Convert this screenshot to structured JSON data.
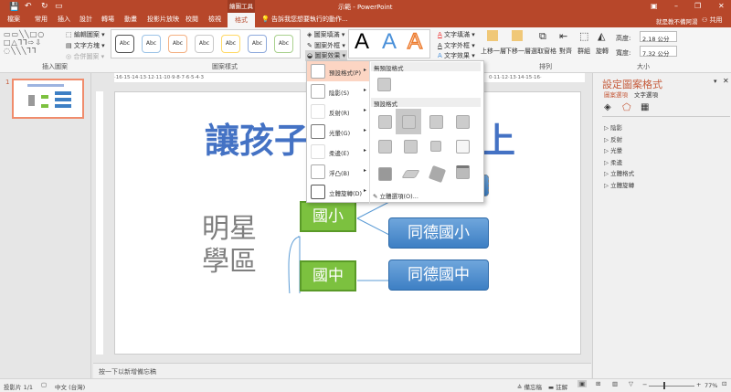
{
  "titlebar": {
    "drawing_tools": "繪圖工具",
    "title": "示範 - PowerPoint",
    "user": "就是教不備阿湯",
    "share": "共用"
  },
  "tabs": [
    "檔案",
    "常用",
    "插入",
    "設計",
    "轉場",
    "動畫",
    "投影片放映",
    "校閱",
    "檢視",
    "格式"
  ],
  "active_tab": "格式",
  "tell_me": "告訴我您想要執行的動作...",
  "ribbon": {
    "insert_shapes": {
      "edit_shape": "編輯圖案",
      "text_box": "文字方塊",
      "merge_shapes": "合併圖案",
      "label": "插入圖案"
    },
    "shape_styles": {
      "sample": "Abc",
      "fill": "圖案填滿",
      "outline": "圖案外框",
      "effects": "圖案效果",
      "label": "圖案樣式"
    },
    "wordart": {
      "sample": "A",
      "text_fill": "文字填滿",
      "text_outline": "文字外框",
      "text_effects": "文字效果"
    },
    "arrange": {
      "bring_forward": "上移一層",
      "send_backward": "下移一層",
      "selection_pane": "選取窗格",
      "align": "對齊",
      "group": "群組",
      "rotate": "旋轉",
      "label": "排列"
    },
    "size": {
      "height_label": "高度:",
      "height": "2.18 公分",
      "width_label": "寬度:",
      "width": "7.32 公分",
      "label": "大小"
    }
  },
  "ruler": {
    "left": "·16·15·14·13·12·11·10·9·8·7·6·5·4·3",
    "right": "0·11·12·13·14·15·16·"
  },
  "slide_number": "1",
  "slide": {
    "title_visible": "讓孩子贏",
    "title_tail": "上",
    "side_label_1": "明星",
    "side_label_2": "學區",
    "green": [
      "國小",
      "國中"
    ],
    "blue": [
      "同德國小",
      "同德國中"
    ]
  },
  "effects_menu": {
    "items": [
      {
        "label": "預設格式(P)"
      },
      {
        "label": "陰影(S)"
      },
      {
        "label": "反射(R)"
      },
      {
        "label": "光暈(G)"
      },
      {
        "label": "柔邊(E)"
      },
      {
        "label": "浮凸(B)"
      },
      {
        "label": "立體旋轉(D)"
      }
    ],
    "no_preset": "無預設格式",
    "presets": "預設格式",
    "options_3d": "立體選項(O)..."
  },
  "pane": {
    "title": "設定圖案格式",
    "tab_shape": "圖案選項",
    "tab_text": "文字選項",
    "sections": [
      "陰影",
      "反射",
      "光暈",
      "柔邊",
      "立體格式",
      "立體旋轉"
    ]
  },
  "notes_placeholder": "按一下以新增備忘稿",
  "status": {
    "slide": "投影片 1/1",
    "language": "中文 (台灣)",
    "notes": "備忘稿",
    "comments": "註解",
    "zoom": "77%"
  },
  "colors": {
    "accent": "#b7472a",
    "title_blue": "#4472c4",
    "green": "#7cc13f"
  }
}
